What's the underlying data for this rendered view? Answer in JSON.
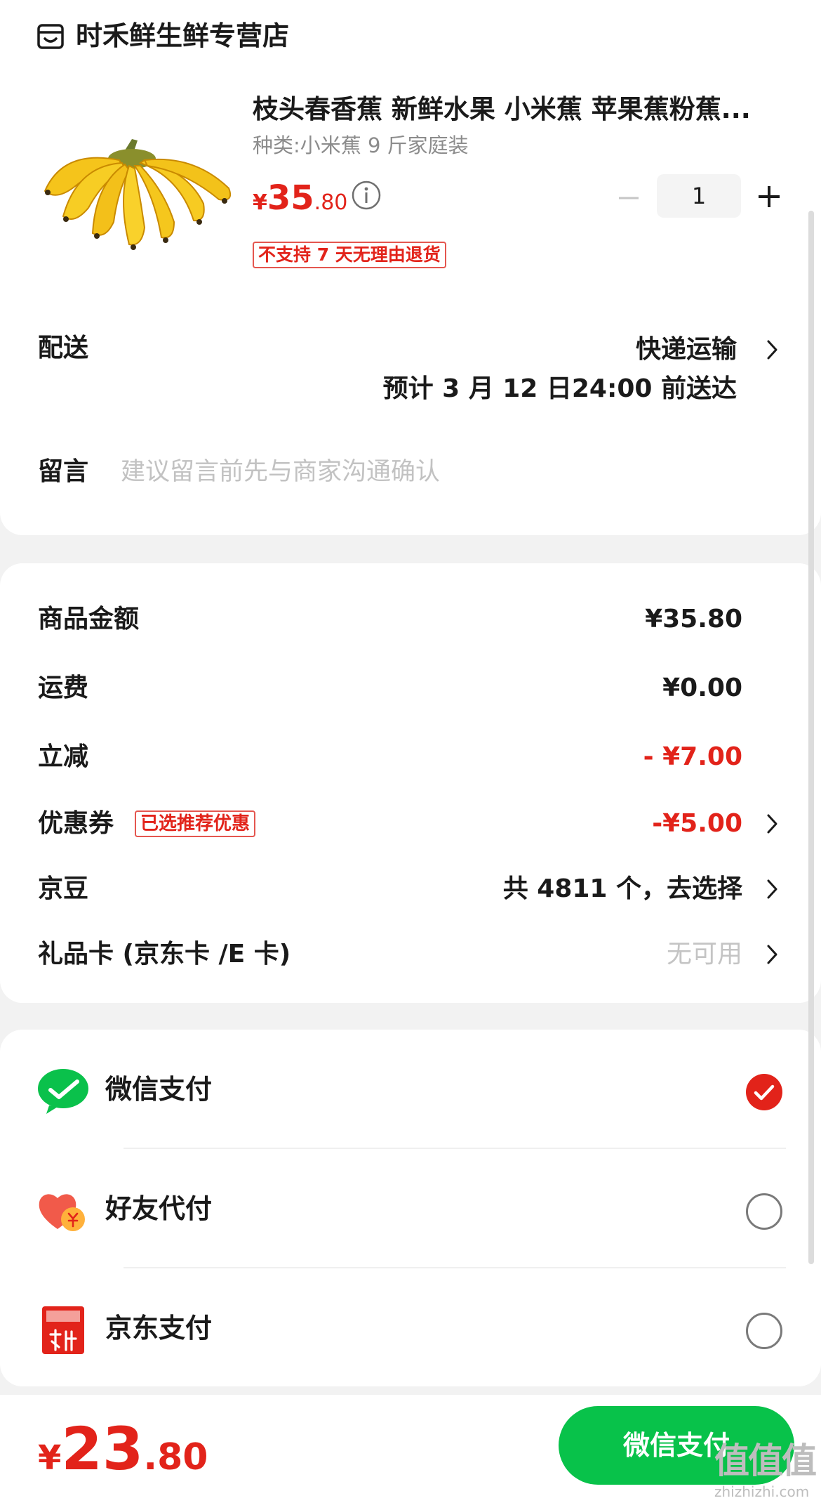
{
  "store": {
    "name": "时禾鲜生鲜专营店",
    "icon": "store-icon"
  },
  "product": {
    "title": "枝头春香蕉 新鲜水果 小米蕉 苹果蕉粉蕉...",
    "spec": "种类:小米蕉 9 斤家庭装",
    "price": {
      "currency": "¥",
      "integer": "35",
      "decimal": ".80"
    },
    "quantity": "1",
    "return_policy": "不支持 7 天无理由退货"
  },
  "delivery": {
    "label": "配送",
    "method": "快递运输",
    "eta": "预计 3 月 12 日24:00 前送达"
  },
  "remark": {
    "label": "留言",
    "placeholder": "建议留言前先与商家沟通确认"
  },
  "pricing": {
    "goods_amount": {
      "label": "商品金额",
      "value": "¥35.80"
    },
    "shipping": {
      "label": "运费",
      "value": "¥0.00"
    },
    "instant_discount": {
      "label": "立减",
      "value": "- ¥7.00"
    },
    "coupon": {
      "label": "优惠券",
      "tag": "已选推荐优惠",
      "value": "-¥5.00"
    },
    "jd_beans": {
      "label": "京豆",
      "value": "共 4811 个，去选择"
    },
    "gift_card": {
      "label": "礼品卡 (京东卡 /E 卡)",
      "value": "无可用"
    }
  },
  "payment_methods": [
    {
      "label": "微信支付",
      "icon": "wechat-pay-icon",
      "selected": true
    },
    {
      "label": "好友代付",
      "icon": "friend-pay-icon",
      "selected": false
    },
    {
      "label": "京东支付",
      "icon": "jd-pay-icon",
      "selected": false
    }
  ],
  "footer": {
    "total": {
      "currency": "¥",
      "integer": "23",
      "decimal": ".80"
    },
    "pay_button": "微信支付",
    "watermark": {
      "logo": "值值值",
      "url": "zhizhizhi.com"
    }
  },
  "colors": {
    "accent_red": "#e2231a",
    "wechat_green": "#08c24a"
  }
}
